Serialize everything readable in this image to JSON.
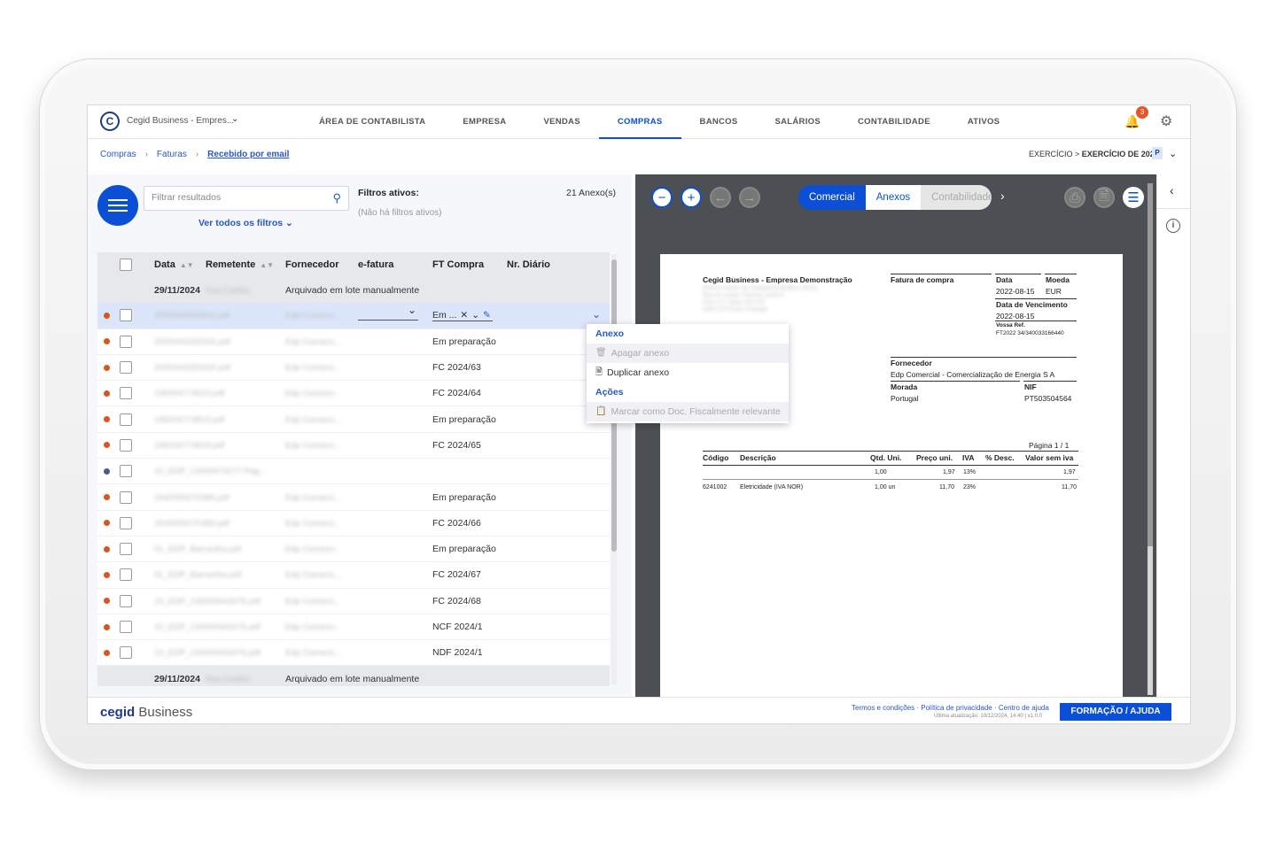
{
  "header": {
    "company": "Cegid Business - Empres...",
    "menu": [
      "ÁREA DE CONTABILISTA",
      "EMPRESA",
      "VENDAS",
      "COMPRAS",
      "BANCOS",
      "SALÁRIOS",
      "CONTABILIDADE",
      "ATIVOS"
    ],
    "active_menu": "COMPRAS",
    "notifications": "3"
  },
  "breadcrumb": [
    "Compras",
    "Faturas",
    "Recebido por email"
  ],
  "exercise": {
    "prefix": "EXERCÍCIO > ",
    "value": "EXERCÍCIO DE 2024",
    "badge": "P"
  },
  "filters": {
    "search_placeholder": "Filtrar resultados",
    "see_all": "Ver todos os filtros",
    "active_title": "Filtros ativos:",
    "active_none": "(Não há filtros ativos)",
    "count": "21 Anexo(s)"
  },
  "table": {
    "headers": [
      "Data",
      "Remetente",
      "Fornecedor",
      "e-fatura",
      "FT Compra",
      "Nr. Diário"
    ],
    "group_date": "29/11/2024",
    "group_sender": "Ana Coelho",
    "group_note": "Arquivado em lote manualmente",
    "rows": [
      {
        "file": "2000045092024.pdf",
        "supplier": "Edp Comerci...",
        "ft": "Em ...",
        "dot": "orange"
      },
      {
        "file": "200004429202A.pdf",
        "supplier": "Edp Comerci...",
        "ft": "Em preparação",
        "dot": "orange"
      },
      {
        "file": "200004429202A.pdf",
        "supplier": "Edp Comerci...",
        "ft": "FC 2024/63",
        "dot": "orange"
      },
      {
        "file": "196004774819.pdf",
        "supplier": "Edp Comerci...",
        "ft": "FC 2024/64",
        "dot": "orange"
      },
      {
        "file": "196004774819.pdf",
        "supplier": "Edp Comerci...",
        "ft": "Em preparação",
        "dot": "orange"
      },
      {
        "file": "196004774819.pdf",
        "supplier": "Edp Comerci...",
        "ft": "FC 2024/65",
        "dot": "orange"
      },
      {
        "file": "10_EDP_14000474277.Pag...",
        "supplier": "",
        "ft": "",
        "dot": "blue"
      },
      {
        "file": "1540059270389.pdf",
        "supplier": "Edp Comerci...",
        "ft": "Em preparação",
        "dot": "orange"
      },
      {
        "file": "1540059270389.pdf",
        "supplier": "Edp Comerci...",
        "ft": "FC 2024/66",
        "dot": "orange"
      },
      {
        "file": "01_EDP_Barrantha.pdf",
        "supplier": "Edp Comerci...",
        "ft": "Em preparação",
        "dot": "orange"
      },
      {
        "file": "01_EDP_Barrantha.pdf",
        "supplier": "Edp Comerci...",
        "ft": "FC 2024/67",
        "dot": "orange"
      },
      {
        "file": "10_EDP_130009442676.pdf",
        "supplier": "Edp Comerci...",
        "ft": "FC 2024/68",
        "dot": "orange"
      },
      {
        "file": "10_EDP_130009442676.pdf",
        "supplier": "Edp Comerci...",
        "ft": "NCF 2024/1",
        "dot": "orange"
      },
      {
        "file": "10_EDP_130009442676.pdf",
        "supplier": "Edp Comerci...",
        "ft": "NDF 2024/1",
        "dot": "orange"
      }
    ]
  },
  "context_menu": {
    "section1": "Anexo",
    "delete": "Apagar anexo",
    "duplicate": "Duplicar anexo",
    "section2": "Ações",
    "mark": "Marcar como Doc. Fiscalmente relevante"
  },
  "viewer": {
    "tabs": [
      "Comercial",
      "Anexos",
      "Contabilidade"
    ],
    "doc": {
      "company": "Cegid Business - Empresa Demonstração",
      "address": [
        "Edifício Centro de Campanhã (Edifício NOS)",
        "Rua de Justino Teixeira, porta 4",
        "Piso 2 C, Salas 222-224",
        "4300-273 Porto, Portugal"
      ],
      "type": "Fatura de compra",
      "date_label": "Data",
      "date": "2022-08-15",
      "currency_label": "Moeda",
      "currency": "EUR",
      "due_label": "Data de Vencimento",
      "due": "2022-08-15",
      "ref_label": "Vossa Ref.",
      "ref": "FT2022 34/340033166440",
      "supplier_label": "Fornecedor",
      "supplier": "Edp Comercial - Comercialização de Energia S A",
      "address_label": "Morada",
      "country": "Portugal",
      "nif_label": "NIF",
      "nif": "PT503504564",
      "page": "Página  1 /   1",
      "cols": [
        "Código",
        "Descrição",
        "Qtd. Uni.",
        "Preço uni.",
        "IVA",
        "% Desc.",
        "Valor sem iva"
      ],
      "summary": {
        "qty": "1,00",
        "price": "1,97",
        "iva": "13%",
        "total": "1,97"
      },
      "line": {
        "code": "6241002",
        "desc": "Eletricidade (IVA NOR)",
        "qty": "1,00 un",
        "price": "11,70",
        "iva": "23%",
        "total": "11,70"
      }
    }
  },
  "footer": {
    "brand_a": "cegid",
    "brand_b": " Business",
    "links": "Termos e condições · Política de privacidade · Centro de ajuda",
    "updated": "Última atualização: 10/12/2024, 14:40 | v1.0.0",
    "help": "FORMAÇÃO / AJUDA"
  }
}
